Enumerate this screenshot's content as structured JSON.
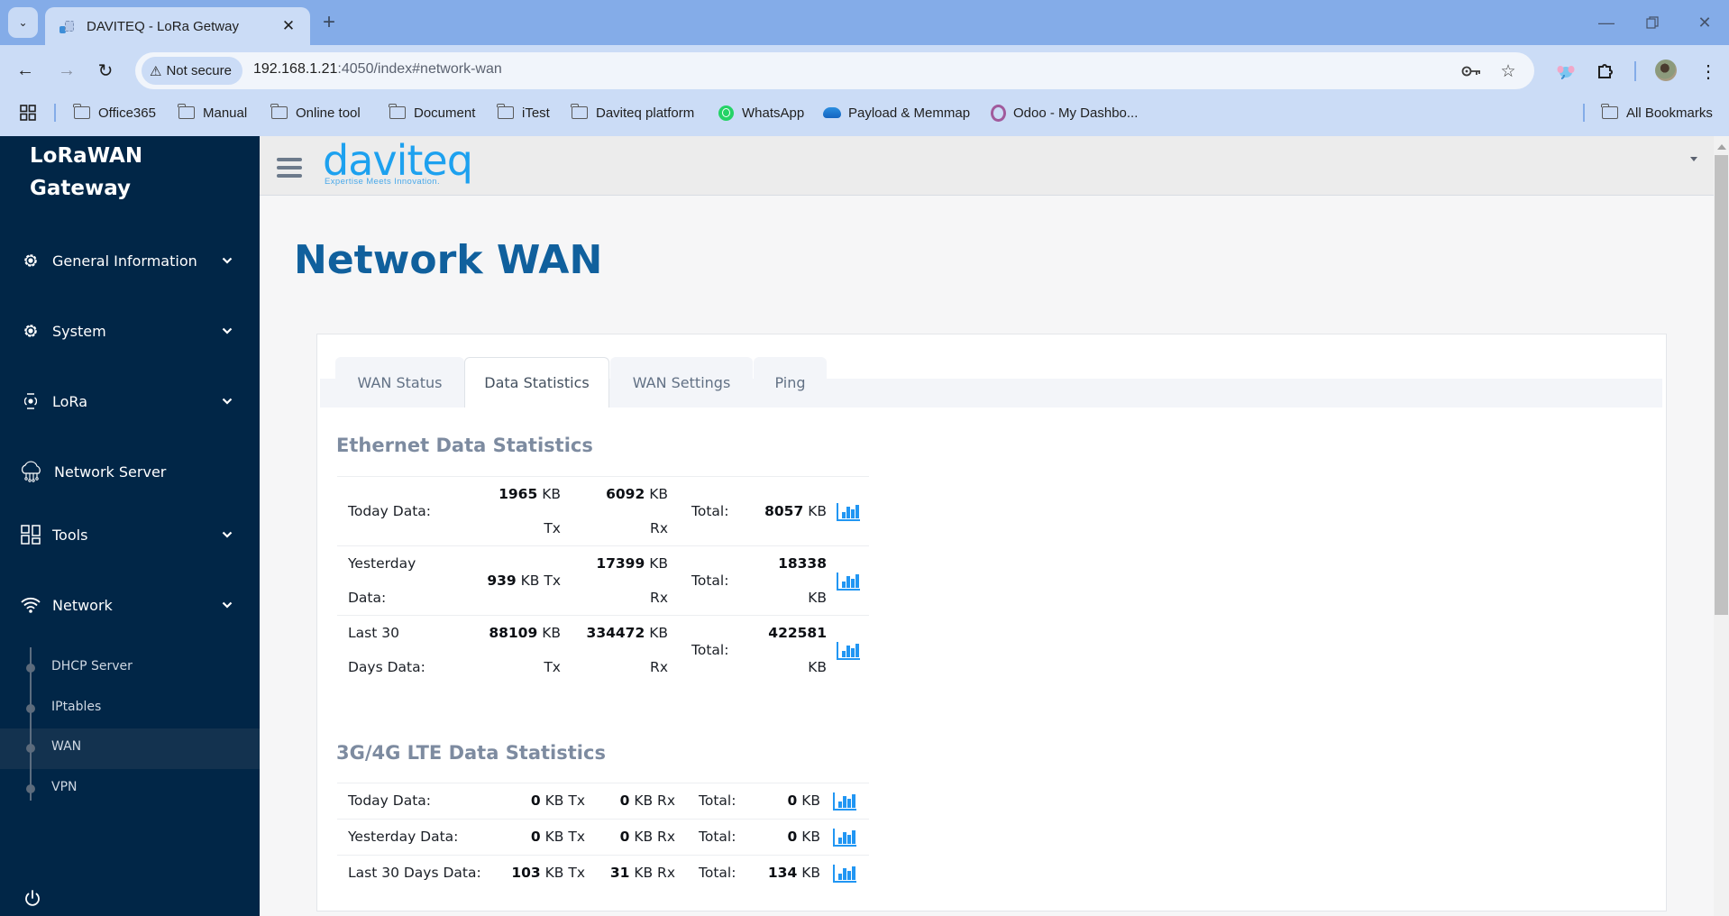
{
  "browser": {
    "tab_title": "DAVITEQ - LoRa Getway",
    "url_host": "192.168.1.21",
    "url_rest": ":4050/index#network-wan",
    "security_label": "Not secure",
    "bookmarks": [
      {
        "label": "Office365",
        "icon": "folder-icon"
      },
      {
        "label": "Manual",
        "icon": "folder-icon"
      },
      {
        "label": "Online tool",
        "icon": "folder-icon"
      },
      {
        "label": "Document",
        "icon": "folder-icon"
      },
      {
        "label": "iTest",
        "icon": "folder-icon"
      },
      {
        "label": "Daviteq platform",
        "icon": "folder-icon"
      },
      {
        "label": "WhatsApp",
        "icon": "whatsapp-icon"
      },
      {
        "label": "Payload & Memmap",
        "icon": "onedrive-icon"
      },
      {
        "label": "Odoo - My Dashbo...",
        "icon": "odoo-icon"
      }
    ],
    "all_bookmarks": "All Bookmarks"
  },
  "sidebar": {
    "brand_line1": "LoRaWAN",
    "brand_line2": "Gateway",
    "items": [
      {
        "label": "General Information",
        "icon": "gear-icon",
        "expandable": true
      },
      {
        "label": "System",
        "icon": "gear-icon",
        "expandable": true
      },
      {
        "label": "LoRa",
        "icon": "antenna-icon",
        "expandable": true
      },
      {
        "label": "Network Server",
        "icon": "cloud-network-icon",
        "expandable": false
      },
      {
        "label": "Tools",
        "icon": "grid-icon",
        "expandable": true
      },
      {
        "label": "Network",
        "icon": "wifi-icon",
        "expandable": true
      }
    ],
    "network_subitems": [
      {
        "label": "DHCP Server",
        "active": false
      },
      {
        "label": "IPtables",
        "active": false
      },
      {
        "label": "WAN",
        "active": true
      },
      {
        "label": "VPN",
        "active": false
      }
    ]
  },
  "header": {
    "logo_word": "daviteq",
    "logo_tagline": "Expertise Meets Innovation."
  },
  "page": {
    "title": "Network WAN",
    "tabs": [
      {
        "label": "WAN Status",
        "active": false
      },
      {
        "label": "Data Statistics",
        "active": true
      },
      {
        "label": "WAN Settings",
        "active": false
      },
      {
        "label": "Ping",
        "active": false
      }
    ],
    "ethernet": {
      "title": "Ethernet Data Statistics",
      "rows": [
        {
          "label": "Today Data:",
          "tx": "1965",
          "rx": "6092",
          "total_label": "Total:",
          "total": "8057",
          "unit": "KB"
        },
        {
          "label": "Yesterday Data:",
          "tx": "939",
          "rx": "17399",
          "total_label": "Total:",
          "total": "18338",
          "unit": "KB"
        },
        {
          "label": "Last 30 Days Data:",
          "tx": "88109",
          "rx": "334472",
          "total_label": "Total:",
          "total": "422581",
          "unit": "KB"
        }
      ]
    },
    "lte": {
      "title": "3G/4G LTE Data Statistics",
      "rows": [
        {
          "label": "Today Data:",
          "tx": "0",
          "rx": "0",
          "total_label": "Total:",
          "total": "0",
          "unit": "KB"
        },
        {
          "label": "Yesterday Data:",
          "tx": "0",
          "rx": "0",
          "total_label": "Total:",
          "total": "0",
          "unit": "KB"
        },
        {
          "label": "Last 30 Days Data:",
          "tx": "103",
          "rx": "31",
          "total_label": "Total:",
          "total": "134",
          "unit": "KB"
        }
      ]
    },
    "tx_suffix": "KB Tx",
    "rx_suffix": "KB Rx",
    "kb": "KB",
    "tx": "Tx",
    "rx": "Rx"
  },
  "colors": {
    "sidebar_bg": "#012647",
    "accent_blue": "#1da1ef",
    "title_blue": "#10609d",
    "chart_icon": "#2196f3"
  }
}
